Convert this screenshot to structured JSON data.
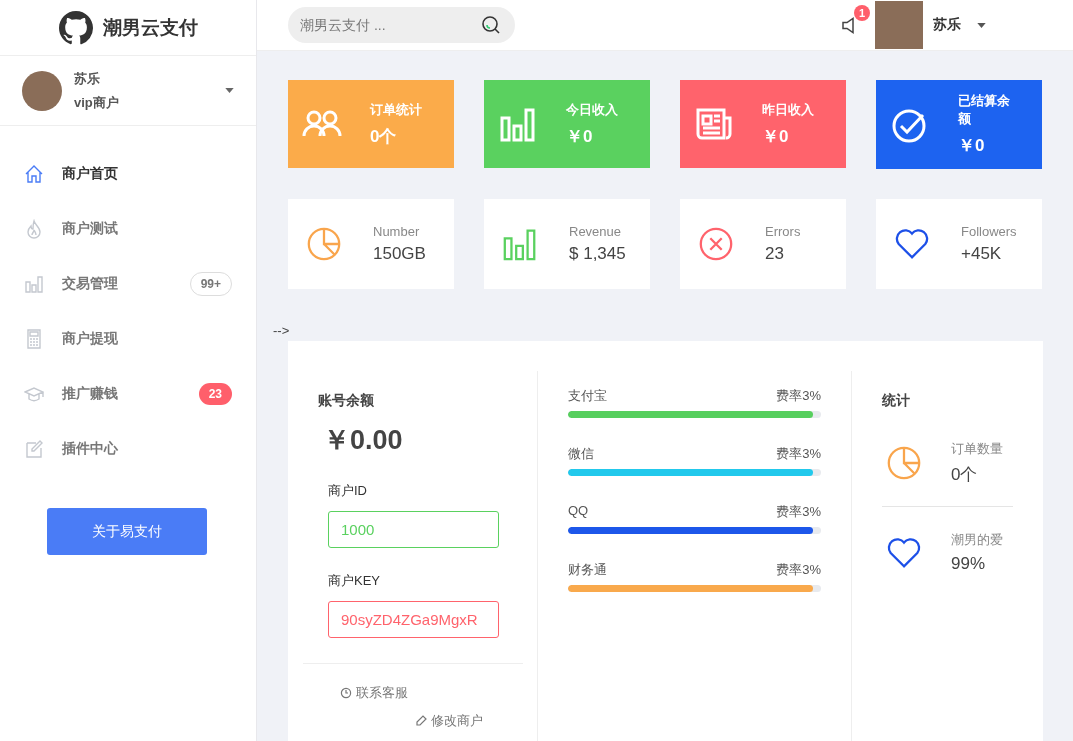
{
  "brand": {
    "name": "潮男云支付"
  },
  "search": {
    "placeholder": "潮男云支付 ..."
  },
  "notifications": {
    "count": "1"
  },
  "header_user": {
    "name": "苏乐"
  },
  "sidebar": {
    "user": {
      "name": "苏乐",
      "role": "vip商户"
    },
    "items": [
      {
        "label": "商户首页",
        "selected": true
      },
      {
        "label": "商户测试",
        "selected": false
      },
      {
        "label": "交易管理",
        "selected": false,
        "badge": {
          "text": "99+",
          "kind": "outline"
        }
      },
      {
        "label": "商户提现",
        "selected": false
      },
      {
        "label": "推广赚钱",
        "selected": false,
        "badge": {
          "text": "23",
          "kind": "filled"
        }
      },
      {
        "label": "插件中心",
        "selected": false
      }
    ],
    "button": "关于易支付"
  },
  "summary_cards": [
    {
      "label": "订单统计",
      "value": "0个",
      "color": "#fbab4a"
    },
    {
      "label": "今日收入",
      "value": "￥0",
      "color": "#5ad15f"
    },
    {
      "label": "昨日收入",
      "value": "￥0",
      "color": "#ff636c"
    },
    {
      "label": "已结算余额",
      "value": "￥0",
      "color": "#1d63f0"
    }
  ],
  "stat_cards": [
    {
      "label": "Number",
      "value": "150GB",
      "color": "#f9a54c"
    },
    {
      "label": "Revenue",
      "value": "$ 1,345",
      "color": "#5ad15f"
    },
    {
      "label": "Errors",
      "value": "23",
      "color": "#ff636c"
    },
    {
      "label": "Followers",
      "value": "+45K",
      "color": "#1d50e8"
    }
  ],
  "stray_text": "-->",
  "balance": {
    "title": "账号余额",
    "amount": "￥0.00",
    "merchant_id_label": "商户ID",
    "merchant_id": "1000",
    "merchant_key_label": "商户KEY",
    "merchant_key": "90syZD4ZGa9MgxR"
  },
  "links": [
    "联系客服",
    "修改商户"
  ],
  "channels": [
    {
      "name": "支付宝",
      "rate": "费率3%",
      "level": 0.97,
      "color": "#57cf5e"
    },
    {
      "name": "微信",
      "rate": "费率3%",
      "level": 0.97,
      "color": "#22c9ec"
    },
    {
      "name": "QQ",
      "rate": "费率3%",
      "level": 0.97,
      "color": "#1d57ea"
    },
    {
      "name": "财务通",
      "rate": "费率3%",
      "level": 0.97,
      "color": "#f9a94c"
    }
  ],
  "stats": {
    "title": "统计",
    "items": [
      {
        "label": "订单数量",
        "value": "0个"
      },
      {
        "label": "潮男的爱",
        "value": "99%"
      }
    ]
  }
}
